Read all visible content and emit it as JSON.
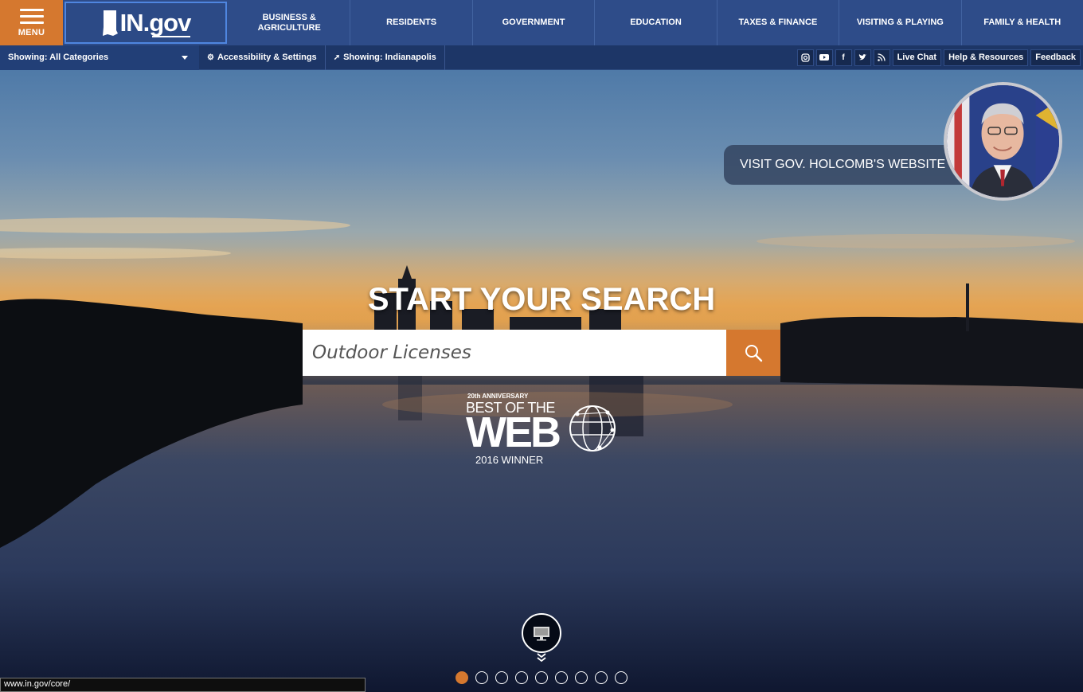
{
  "menu": {
    "label": "MENU"
  },
  "logo": {
    "text": "IN.gov"
  },
  "nav": {
    "items": [
      {
        "label": "BUSINESS & AGRICULTURE"
      },
      {
        "label": "RESIDENTS"
      },
      {
        "label": "GOVERNMENT"
      },
      {
        "label": "EDUCATION"
      },
      {
        "label": "TAXES & FINANCE"
      },
      {
        "label": "VISITING & PLAYING"
      },
      {
        "label": "FAMILY & HEALTH"
      }
    ]
  },
  "subbar": {
    "category": "Showing: All Categories",
    "accessibility": "Accessibility & Settings",
    "location": "Showing: Indianapolis",
    "social": [
      {
        "icon": "instagram-icon"
      },
      {
        "icon": "youtube-icon"
      },
      {
        "icon": "facebook-icon"
      },
      {
        "icon": "twitter-icon"
      },
      {
        "icon": "rss-icon"
      }
    ],
    "live_chat": "Live Chat",
    "help": "Help & Resources",
    "feedback": "Feedback"
  },
  "hero": {
    "title": "START YOUR SEARCH",
    "search_value": "Outdoor Licenses",
    "governor_link": "VISIT GOV. HOLCOMB'S WEBSITE",
    "award": {
      "anniversary": "20th ANNIVERSARY",
      "best": "BEST OF THE",
      "web": "WEB",
      "winner": "2016 WINNER"
    },
    "slides": {
      "count": 9,
      "active": 0
    }
  },
  "colors": {
    "accent": "#d5782f",
    "nav": "#2e4c89",
    "subnav": "#1d3667"
  },
  "status_url": "www.in.gov/core/"
}
